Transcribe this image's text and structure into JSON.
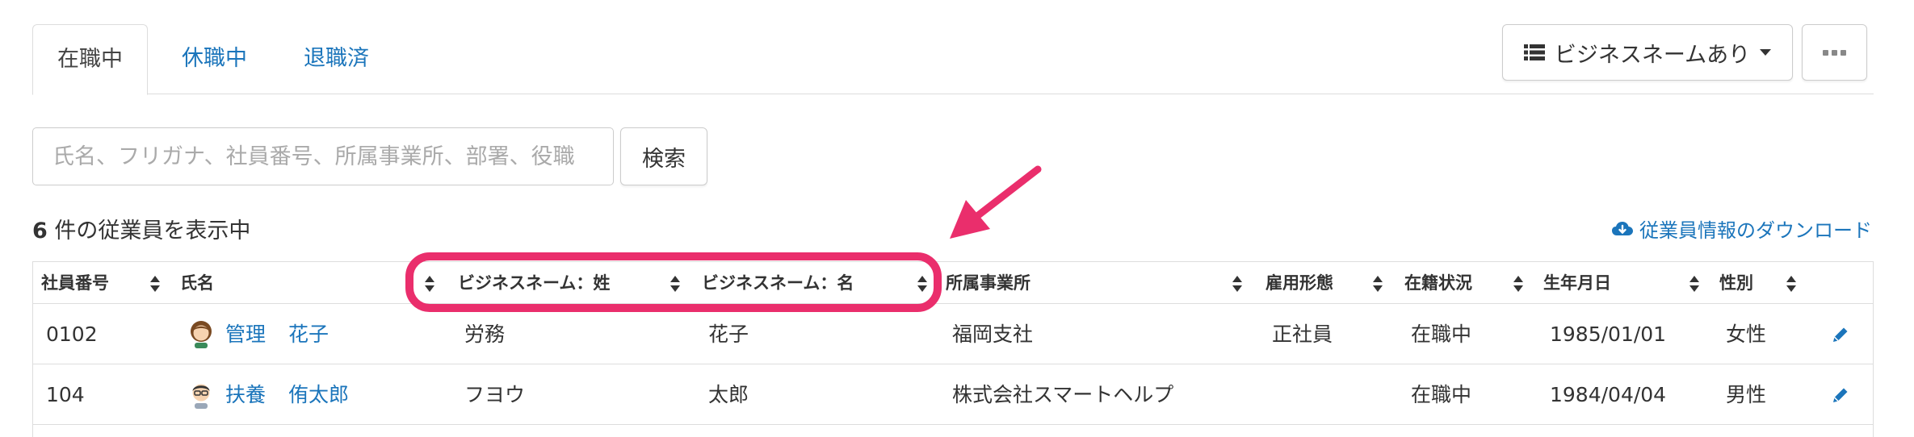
{
  "tabs": [
    {
      "label": "在職中",
      "active": true
    },
    {
      "label": "休職中",
      "active": false
    },
    {
      "label": "退職済",
      "active": false
    }
  ],
  "view_button": {
    "label": "ビジネスネームあり",
    "icon": "list-icon"
  },
  "more_button": {
    "icon": "ellipsis-icon"
  },
  "search": {
    "placeholder": "氏名、フリガナ、社員番号、所属事業所、部署、役職",
    "value": "",
    "button_label": "検索"
  },
  "count": {
    "number": "6",
    "text": " 件の従業員を表示中"
  },
  "download": {
    "label": "従業員情報のダウンロード",
    "icon": "cloud-download-icon"
  },
  "table": {
    "headers": [
      "社員番号",
      "氏名",
      "ビジネスネーム：姓",
      "ビジネスネーム：名",
      "所属事業所",
      "雇用形態",
      "在籍状況",
      "生年月日",
      "性別"
    ],
    "rows": [
      {
        "id": "0102",
        "last": "管理",
        "first": "花子",
        "bn_last": "労務",
        "bn_first": "花子",
        "office": "福岡支社",
        "employment": "正社員",
        "status": "在職中",
        "birth": "1985/01/01",
        "gender": "女性"
      },
      {
        "id": "104",
        "last": "扶養",
        "first": "侑太郎",
        "bn_last": "フヨウ",
        "bn_first": "太郎",
        "office": "株式会社スマートヘルプ",
        "employment": "",
        "status": "在職中",
        "birth": "1984/04/04",
        "gender": "男性"
      }
    ]
  },
  "colors": {
    "link": "#1b75bb",
    "highlight": "#ea2e6c",
    "border": "#dddddd"
  }
}
